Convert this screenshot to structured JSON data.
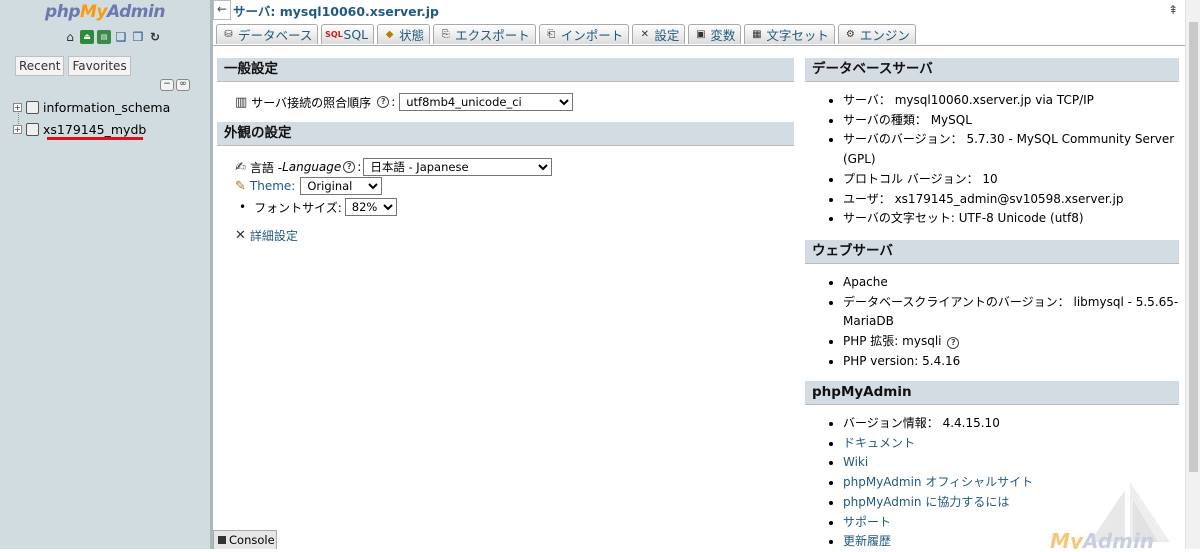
{
  "nav": {
    "logo": {
      "php": "php",
      "my": "My",
      "admin": "Admin"
    },
    "icons": [
      "home-icon",
      "exit-icon",
      "sql-query-icon",
      "docs-icon",
      "phpmyadmin-docs-icon",
      "reload-icon"
    ],
    "tabs": {
      "recent": "Recent",
      "favorites": "Favorites"
    },
    "databases": [
      {
        "name": "information_schema"
      },
      {
        "name": "xs179145_mydb"
      }
    ],
    "highlight_color": "#d8151f"
  },
  "breadcrumb": {
    "server": "サーバ: mysql10060.xserver.jp"
  },
  "tabs": [
    {
      "label": "データベース"
    },
    {
      "label": "SQL"
    },
    {
      "label": "状態"
    },
    {
      "label": "エクスポート"
    },
    {
      "label": "インポート"
    },
    {
      "label": "設定"
    },
    {
      "label": "変数"
    },
    {
      "label": "文字セット"
    },
    {
      "label": "エンジン"
    }
  ],
  "general": {
    "title": "一般設定",
    "collation_label": "サーバ接続の照合順序",
    "collation_value": "utf8mb4_unicode_ci"
  },
  "appearance": {
    "title": "外観の設定",
    "language_label": "言語 - ",
    "language_label_en": "Language",
    "language_value": "日本語 - Japanese",
    "theme_label": "Theme:",
    "theme_value": "Original",
    "fontsize_label": "フォントサイズ:",
    "fontsize_value": "82%",
    "more_settings": "詳細設定"
  },
  "db_server": {
    "title": "データベースサーバ",
    "items": [
      "サーバ： mysql10060.xserver.jp via TCP/IP",
      "サーバの種類： MySQL",
      "サーバのバージョン： 5.7.30 - MySQL Community Server (GPL)",
      "プロトコル バージョン： 10",
      "ユーザ： xs179145_admin@sv10598.xserver.jp",
      "サーバの文字セット: UTF-8 Unicode (utf8)"
    ]
  },
  "web_server": {
    "title": "ウェブサーバ",
    "items": [
      "Apache",
      "データベースクライアントのバージョン： libmysql - 5.5.65-MariaDB",
      "PHP 拡張: mysqli",
      "PHP version: 5.4.16"
    ]
  },
  "pma": {
    "title": "phpMyAdmin",
    "version": "バージョン情報： 4.4.15.10",
    "links": [
      "ドキュメント",
      "Wiki",
      "phpMyAdmin オフィシャルサイト",
      "phpMyAdmin に協力するには",
      "サポート",
      "更新履歴"
    ]
  },
  "console": {
    "label": "Console"
  },
  "watermark": {
    "my": "My",
    "admin": "Admin"
  }
}
